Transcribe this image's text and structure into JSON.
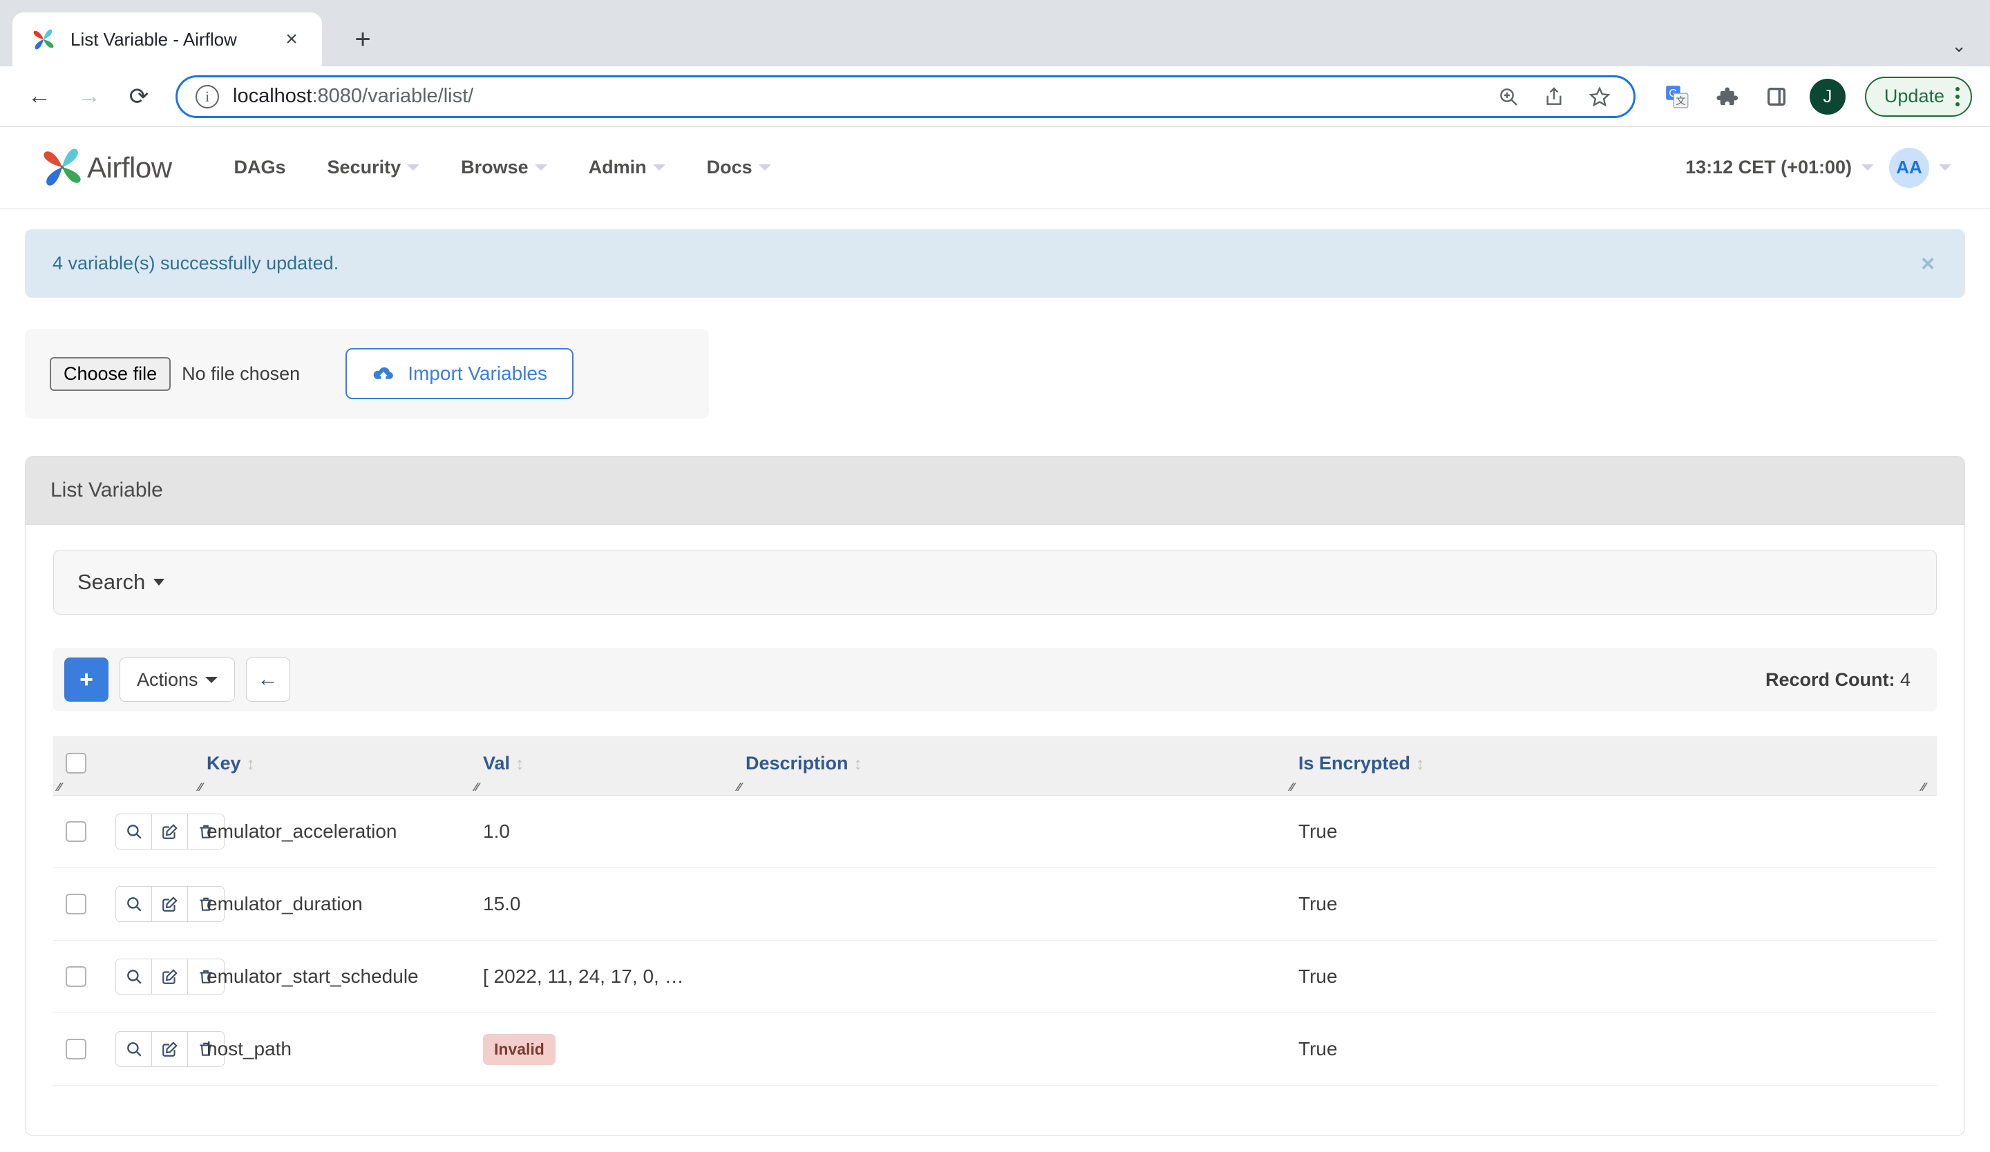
{
  "browser": {
    "tab": {
      "title": "List Variable - Airflow",
      "favicon": "airflow-pinwheel-icon",
      "close": "×"
    },
    "new_tab": "+",
    "expand": "⌄",
    "back": "←",
    "forward": "→",
    "reload": "⟳",
    "url_main": "localhost",
    "url_rest": ":8080/variable/list/",
    "omni_icons": [
      "zoom-icon",
      "share-icon",
      "bookmark-star-icon"
    ],
    "ext_icons": [
      "google-translate-icon",
      "extensions-puzzle-icon",
      "side-panel-icon"
    ],
    "profile_initial": "J",
    "update_label": "Update"
  },
  "airflow_nav": {
    "brand": "Airflow",
    "links": [
      {
        "label": "DAGs",
        "has_caret": false
      },
      {
        "label": "Security",
        "has_caret": true
      },
      {
        "label": "Browse",
        "has_caret": true
      },
      {
        "label": "Admin",
        "has_caret": true
      },
      {
        "label": "Docs",
        "has_caret": true
      }
    ],
    "time": "13:12 CET (+01:00)",
    "avatar_initials": "AA"
  },
  "alert": {
    "message": "4 variable(s) successfully updated.",
    "close": "×"
  },
  "import": {
    "choose_file_label": "Choose file",
    "no_file_label": "No file chosen",
    "import_button_label": "Import Variables"
  },
  "panel": {
    "title": "List Variable",
    "search_label": "Search",
    "toolbar": {
      "add_label": "+",
      "actions_label": "Actions",
      "back_label": "←",
      "record_count_label": "Record Count:",
      "record_count_value": "4"
    },
    "table": {
      "columns": [
        "Key",
        "Val",
        "Description",
        "Is Encrypted"
      ],
      "sort_arrow": "↕",
      "rows": [
        {
          "key": "emulator_acceleration",
          "val": "1.0",
          "val_invalid": false,
          "description": "",
          "is_encrypted": "True"
        },
        {
          "key": "emulator_duration",
          "val": "15.0",
          "val_invalid": false,
          "description": "",
          "is_encrypted": "True"
        },
        {
          "key": "emulator_start_schedule",
          "val": "[ 2022, 11, 24, 17, 0, …",
          "val_invalid": false,
          "description": "",
          "is_encrypted": "True"
        },
        {
          "key": "host_path",
          "val": "Invalid",
          "val_invalid": true,
          "description": "",
          "is_encrypted": "True"
        }
      ],
      "row_action_icons": [
        "search-icon",
        "edit-icon",
        "delete-icon"
      ]
    }
  },
  "colors": {
    "accent_blue": "#3b7ddd",
    "header_blue": "#31598e",
    "alert_bg": "#dce9f3",
    "alert_text": "#31708f",
    "invalid_bg": "#f2cfca",
    "invalid_text": "#7b3b33",
    "chrome_bg": "#dee1e6"
  }
}
